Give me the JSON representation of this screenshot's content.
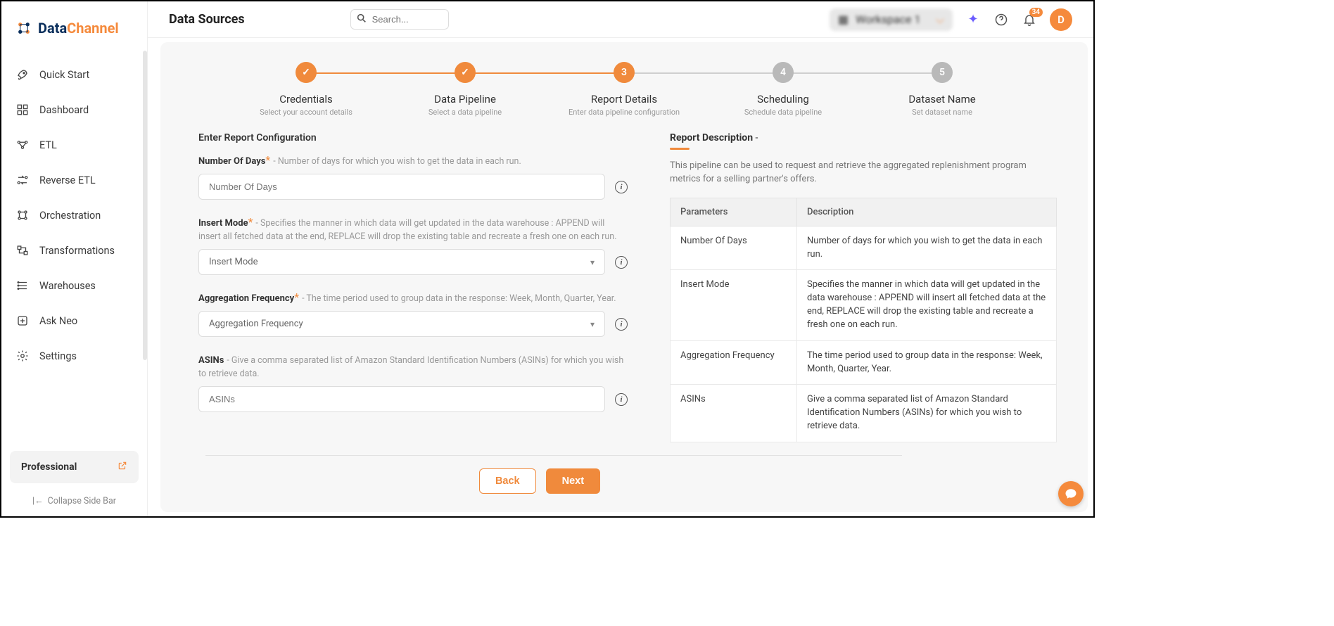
{
  "brand": {
    "word1": "Data",
    "word2": "Channel"
  },
  "sidebar": {
    "items": [
      {
        "label": "Quick Start"
      },
      {
        "label": "Dashboard"
      },
      {
        "label": "ETL"
      },
      {
        "label": "Reverse ETL"
      },
      {
        "label": "Orchestration"
      },
      {
        "label": "Transformations"
      },
      {
        "label": "Warehouses"
      },
      {
        "label": "Ask Neo"
      },
      {
        "label": "Settings"
      }
    ],
    "plan_label": "Professional",
    "collapse_label": "Collapse Side Bar"
  },
  "header": {
    "page_title": "Data Sources",
    "search_placeholder": "Search...",
    "workspace_label": "Workspace 1",
    "notification_count": "34",
    "avatar_initial": "D"
  },
  "stepper": [
    {
      "title": "Credentials",
      "sub": "Select your account details",
      "state": "done"
    },
    {
      "title": "Data Pipeline",
      "sub": "Select a data pipeline",
      "state": "done"
    },
    {
      "title": "Report Details",
      "sub": "Enter data pipeline configuration",
      "state": "active",
      "num": "3"
    },
    {
      "title": "Scheduling",
      "sub": "Schedule data pipeline",
      "state": "pending",
      "num": "4"
    },
    {
      "title": "Dataset Name",
      "sub": "Set dataset name",
      "state": "pending",
      "num": "5"
    }
  ],
  "form": {
    "section_title": "Enter Report Configuration",
    "fields": {
      "days": {
        "label": "Number Of Days",
        "required": true,
        "help": "- Number of days for which you wish to get the data in each run.",
        "placeholder": "Number Of Days"
      },
      "insert_mode": {
        "label": "Insert Mode",
        "required": true,
        "help": "- Specifies the manner in which data will get updated in the data warehouse : APPEND will insert all fetched data at the end, REPLACE will drop the existing table and recreate a fresh one on each run.",
        "placeholder": "Insert Mode"
      },
      "agg_freq": {
        "label": "Aggregation Frequency",
        "required": true,
        "help": "- The time period used to group data in the response: Week, Month, Quarter, Year.",
        "placeholder": "Aggregation Frequency"
      },
      "asins": {
        "label": "ASINs",
        "required": false,
        "help": "- Give a comma separated list of Amazon Standard Identification Numbers (ASINs) for which you wish to retrieve data.",
        "placeholder": "ASINs"
      }
    }
  },
  "desc": {
    "head": "Report Description",
    "dash": " -",
    "text": "This pipeline can be used to request and retrieve the aggregated replenishment program metrics for a selling partner's offers.",
    "table": {
      "h1": "Parameters",
      "h2": "Description",
      "rows": [
        {
          "p": "Number Of Days",
          "d": "Number of days for which you wish to get the data in each run."
        },
        {
          "p": "Insert Mode",
          "d": "Specifies the manner in which data will get updated in the data warehouse : APPEND will insert all fetched data at the end, REPLACE will drop the existing table and recreate a fresh one on each run."
        },
        {
          "p": "Aggregation Frequency",
          "d": "The time period used to group data in the response: Week, Month, Quarter, Year."
        },
        {
          "p": "ASINs",
          "d": "Give a comma separated list of Amazon Standard Identification Numbers (ASINs) for which you wish to retrieve data."
        }
      ]
    }
  },
  "buttons": {
    "back": "Back",
    "next": "Next"
  }
}
